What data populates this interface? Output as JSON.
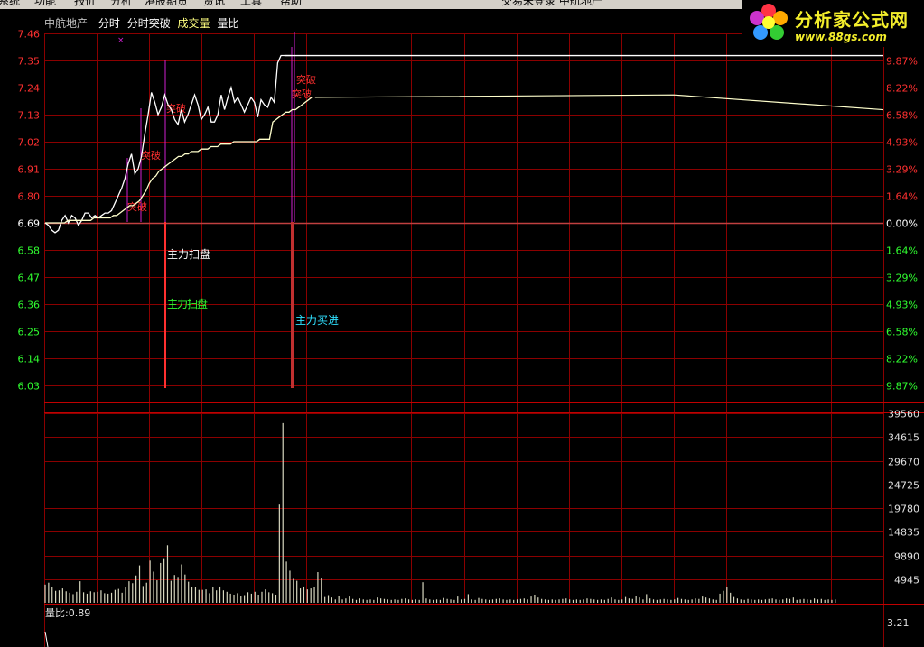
{
  "menu": [
    "系统",
    "功能",
    "报价",
    "分析",
    "港股期货",
    "资讯",
    "工具",
    "帮助"
  ],
  "window_title": "交易未登录  中航地产",
  "logo": {
    "text": "分析家公式网",
    "url": "www.88gs.com"
  },
  "header": {
    "stock": "中航地产",
    "tab1": "分时",
    "tab2": "分时突破",
    "vol_label": "成交量",
    "ratio_label": "量比"
  },
  "colors": {
    "up": "#ff3030",
    "down": "#30ff30",
    "grid": "#8b0000",
    "price_line": "#ffffff",
    "avg_line": "#ffffcc",
    "purple": "#d020d0"
  },
  "price_axis": {
    "labels": [
      "7.46",
      "7.35",
      "7.24",
      "7.13",
      "7.02",
      "6.91",
      "6.80",
      "6.69",
      "6.58",
      "6.47",
      "6.36",
      "6.25",
      "6.14",
      "6.03"
    ],
    "pct_labels": [
      "9.87%",
      "8.22%",
      "6.58%",
      "4.93%",
      "3.29%",
      "1.64%",
      "0.00%",
      "1.64%",
      "3.29%",
      "4.93%",
      "6.58%",
      "8.22%",
      "9.87%"
    ],
    "prev_close": 6.69,
    "range": [
      6.03,
      7.46
    ]
  },
  "volume_axis": {
    "labels": [
      "39560",
      "34615",
      "29670",
      "24725",
      "19780",
      "14835",
      "9890",
      "4945"
    ],
    "max": 39560
  },
  "ratio_panel": {
    "label": "量比:0.89",
    "axis_value": "3.21"
  },
  "annotations": {
    "breakout": "突破",
    "main_sweep": "主力扫盘",
    "sweep_green": "主力扫盘",
    "buy_cyan": "主力买进"
  },
  "chart_data": {
    "type": "line",
    "x_minutes": 240,
    "series": [
      {
        "values": [
          6.69,
          6.68,
          6.66,
          6.65,
          6.66,
          6.7,
          6.72,
          6.69,
          6.72,
          6.71,
          6.68,
          6.7,
          6.73,
          6.73,
          6.71,
          6.72,
          6.71,
          6.72,
          6.73,
          6.73,
          6.74,
          6.77,
          6.8,
          6.83,
          6.87,
          6.93,
          6.97,
          6.89,
          6.91,
          6.96,
          7.05,
          7.13,
          7.22,
          7.18,
          7.13,
          7.16,
          7.21,
          7.17,
          7.15,
          7.11,
          7.09,
          7.15,
          7.1,
          7.13,
          7.17,
          7.21,
          7.17,
          7.11,
          7.13,
          7.16,
          7.1,
          7.1,
          7.13,
          7.21,
          7.15,
          7.2,
          7.24,
          7.18,
          7.2,
          7.17,
          7.14,
          7.17,
          7.2,
          7.18,
          7.12,
          7.19,
          7.17,
          7.16,
          7.2,
          7.18,
          7.34,
          7.37,
          7.37,
          7.37,
          7.37
        ]
      },
      {
        "values": [
          6.69,
          6.69,
          6.69,
          6.69,
          6.69,
          6.69,
          6.69,
          6.7,
          6.7,
          6.7,
          6.7,
          6.7,
          6.7,
          6.7,
          6.7,
          6.71,
          6.71,
          6.71,
          6.71,
          6.71,
          6.71,
          6.72,
          6.72,
          6.73,
          6.74,
          6.75,
          6.76,
          6.76,
          6.77,
          6.78,
          6.8,
          6.82,
          6.85,
          6.87,
          6.88,
          6.9,
          6.91,
          6.92,
          6.93,
          6.94,
          6.95,
          6.96,
          6.96,
          6.97,
          6.97,
          6.98,
          6.98,
          6.98,
          6.99,
          6.99,
          6.99,
          7.0,
          7.0,
          7.0,
          7.01,
          7.01,
          7.01,
          7.01,
          7.02,
          7.02,
          7.02,
          7.02,
          7.02,
          7.02,
          7.02,
          7.02,
          7.03,
          7.03,
          7.03,
          7.03,
          7.1,
          7.11,
          7.12,
          7.13,
          7.14,
          7.14,
          7.15,
          7.15,
          7.16,
          7.17,
          7.18,
          7.19,
          7.2
        ]
      }
    ],
    "volume": [
      3800,
      4200,
      3300,
      2500,
      2600,
      3000,
      2400,
      2100,
      1800,
      2300,
      4500,
      2200,
      1900,
      2400,
      2200,
      2300,
      2600,
      2000,
      1900,
      2100,
      2700,
      2900,
      2100,
      3200,
      4500,
      4100,
      5700,
      7800,
      3500,
      4200,
      8800,
      6500,
      4700,
      8300,
      9300,
      12000,
      4600,
      5800,
      5400,
      8000,
      5900,
      4400,
      3200,
      3200,
      2700,
      2700,
      2800,
      2000,
      3200,
      2600,
      3400,
      2600,
      2300,
      1900,
      1700,
      2000,
      1400,
      1600,
      2200,
      1900,
      2300,
      1700,
      2300,
      2800,
      2200,
      2000,
      1700,
      20500,
      37500,
      8600,
      6700,
      5000,
      4600,
      3000,
      3400,
      2800,
      3000,
      3300,
      6400,
      5100,
      1200,
      1600,
      1100,
      700,
      1500,
      700,
      900,
      1300,
      800,
      600,
      900,
      700,
      600,
      700,
      600,
      1100,
      900,
      800,
      700,
      600,
      700,
      600,
      800,
      900,
      700,
      600,
      700,
      600,
      4300,
      900,
      700,
      600,
      700,
      600,
      1000,
      800,
      700,
      600,
      1300,
      700,
      800,
      1800,
      700,
      600,
      1000,
      800,
      700,
      600,
      700,
      800,
      900,
      700,
      600,
      700,
      600,
      700,
      800,
      900,
      700,
      1300,
      1700,
      1100,
      800,
      700,
      600,
      700,
      600,
      700,
      800,
      900,
      700,
      600,
      700,
      600,
      700,
      900,
      800,
      700,
      600,
      700,
      600,
      800,
      1100,
      700,
      600,
      700,
      1200,
      900,
      800,
      1500,
      1100,
      700,
      1800,
      900,
      700,
      600,
      700,
      800,
      700,
      600,
      700,
      1000,
      800,
      700,
      600,
      700,
      900,
      800,
      1300,
      1100,
      900,
      700,
      600,
      1900,
      2500,
      3200,
      2100,
      1200,
      900,
      700,
      600,
      800,
      700,
      600,
      700,
      600,
      700,
      800,
      900,
      700,
      600,
      700,
      900,
      800,
      1100,
      600,
      700,
      800,
      700,
      600,
      900,
      700,
      800,
      600,
      700,
      600,
      700
    ]
  }
}
